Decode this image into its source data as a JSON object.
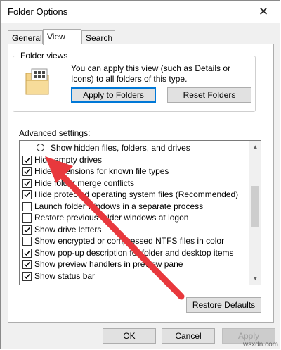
{
  "window": {
    "title": "Folder Options",
    "close_glyph": "✕"
  },
  "tabs": [
    {
      "label": "General",
      "active": false
    },
    {
      "label": "View",
      "active": true
    },
    {
      "label": "Search",
      "active": false
    }
  ],
  "folder_views": {
    "title": "Folder views",
    "description": "You can apply this view (such as Details or Icons) to all folders of this type.",
    "apply_button": "Apply to Folders",
    "reset_button": "Reset Folders",
    "icon": "folder-view-icon"
  },
  "advanced": {
    "label": "Advanced settings:",
    "items": [
      {
        "type": "radio",
        "label": "Show hidden files, folders, and drives",
        "checked": false
      },
      {
        "type": "checkbox",
        "label": "Hide empty drives",
        "checked": true
      },
      {
        "type": "checkbox",
        "label": "Hide extensions for known file types",
        "checked": true
      },
      {
        "type": "checkbox",
        "label": "Hide folder merge conflicts",
        "checked": true
      },
      {
        "type": "checkbox",
        "label": "Hide protected operating system files (Recommended)",
        "checked": true
      },
      {
        "type": "checkbox",
        "label": "Launch folder windows in a separate process",
        "checked": false
      },
      {
        "type": "checkbox",
        "label": "Restore previous folder windows at logon",
        "checked": false
      },
      {
        "type": "checkbox",
        "label": "Show drive letters",
        "checked": true
      },
      {
        "type": "checkbox",
        "label": "Show encrypted or compressed NTFS files in color",
        "checked": false
      },
      {
        "type": "checkbox",
        "label": "Show pop-up description for folder and desktop items",
        "checked": true
      },
      {
        "type": "checkbox",
        "label": "Show preview handlers in preview pane",
        "checked": true
      },
      {
        "type": "checkbox",
        "label": "Show status bar",
        "checked": true
      }
    ]
  },
  "restore_button": "Restore Defaults",
  "footer": {
    "ok": "OK",
    "cancel": "Cancel",
    "apply": "Apply"
  },
  "annotation": {
    "arrow_color": "#e8383d"
  },
  "watermark": "wsxdn.com"
}
